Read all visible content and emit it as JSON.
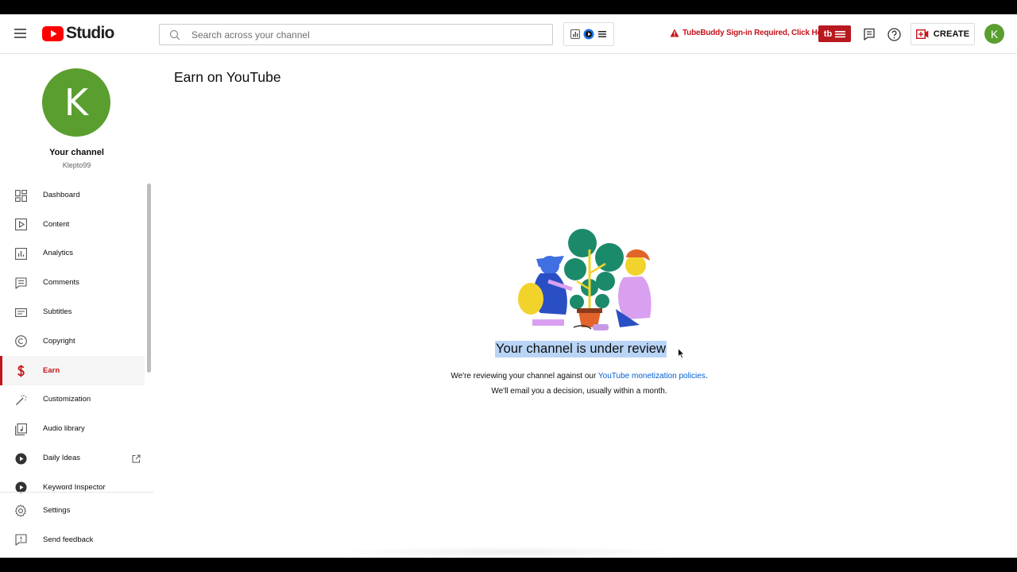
{
  "header": {
    "logo_text": "Studio",
    "search_placeholder": "Search across your channel",
    "tubebuddy_warning": "TubeBuddy Sign-in Required, Click Here",
    "tubebuddy_badge": "tb",
    "create_label": "CREATE",
    "avatar_initial": "K",
    "brand_color": "#ff0000",
    "tubebuddy_color": "#b8181f"
  },
  "channel": {
    "avatar_initial": "K",
    "title": "Your channel",
    "handle": "Klepto99",
    "avatar_color": "#5a9e2f"
  },
  "sidebar": {
    "items": [
      {
        "label": "Dashboard",
        "icon": "dashboard-icon"
      },
      {
        "label": "Content",
        "icon": "content-icon"
      },
      {
        "label": "Analytics",
        "icon": "analytics-icon"
      },
      {
        "label": "Comments",
        "icon": "comments-icon"
      },
      {
        "label": "Subtitles",
        "icon": "subtitles-icon"
      },
      {
        "label": "Copyright",
        "icon": "copyright-icon"
      },
      {
        "label": "Earn",
        "icon": "dollar-icon",
        "active": true
      },
      {
        "label": "Customization",
        "icon": "magic-wand-icon"
      },
      {
        "label": "Audio library",
        "icon": "audio-library-icon"
      },
      {
        "label": "Daily Ideas",
        "icon": "tubebuddy-icon"
      },
      {
        "label": "Keyword Inspector",
        "icon": "tubebuddy-icon"
      }
    ],
    "bottom_items": [
      {
        "label": "Settings",
        "icon": "gear-icon"
      },
      {
        "label": "Send feedback",
        "icon": "feedback-icon"
      }
    ],
    "active_color": "#c4141b"
  },
  "main": {
    "page_title": "Earn on YouTube",
    "review_title": "Your channel is under review",
    "review_desc_prefix": "We're reviewing your channel against our",
    "review_desc_link": "YouTube monetization policies",
    "review_desc_suffix": ".",
    "review_desc_line2": "We'll email you a decision, usually within a month.",
    "link_color": "#065fd4",
    "highlight_color": "#b9d4f5"
  }
}
